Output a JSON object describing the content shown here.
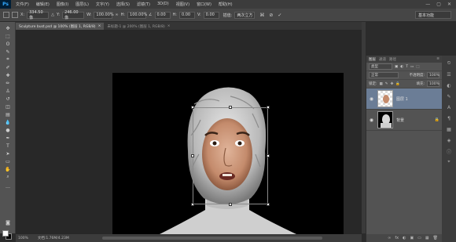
{
  "app": {
    "logo": "Ps"
  },
  "menu": [
    "文件(F)",
    "编辑(E)",
    "图像(I)",
    "图层(L)",
    "文字(Y)",
    "选择(S)",
    "滤镜(T)",
    "3D(D)",
    "视图(V)",
    "窗口(W)",
    "帮助(H)"
  ],
  "window_controls": [
    "—",
    "▢",
    "✕"
  ],
  "options": {
    "x_label": "X:",
    "x_value": "334.50 像",
    "y_label": "Y:",
    "y_value": "246.00 像",
    "w_label": "W:",
    "w_value": "100.00%",
    "h_label": "H:",
    "h_value": "100.00%",
    "angle_value": "0.00",
    "hskew_label": "H:",
    "hskew_value": "0.00",
    "vskew_label": "V:",
    "vskew_value": "0.00",
    "interp_value": "两次立方",
    "workspace": "基本功能"
  },
  "tabs": [
    {
      "label": "Sculpture bust.psd @ 100% (图层 1, RGB/8)",
      "close": "×"
    },
    {
      "label": "未标题-1 @ 200% (图层 1, RGB/8)",
      "close": "×"
    }
  ],
  "status": {
    "zoom": "100%",
    "doc": "文档:1.76M/4.23M"
  },
  "layers_panel": {
    "tabs": [
      "图层",
      "通道",
      "路径"
    ],
    "filter_kind": "类型",
    "blend_mode": "正常",
    "opacity_label": "不透明度:",
    "opacity_value": "100%",
    "lock_label": "锁定:",
    "fill_label": "填充:",
    "fill_value": "100%",
    "layers": [
      {
        "name": "图层 1",
        "visible_icon": "◉",
        "selected": true
      },
      {
        "name": "背景",
        "visible_icon": "◉",
        "selected": false,
        "lock": "🔒"
      }
    ],
    "footer_icons": [
      "fx",
      "◐",
      "▣",
      "▭",
      "▦",
      "🗑"
    ]
  },
  "colors": {
    "accent": "#31a8ff",
    "selected_layer": "#6b7d96",
    "panel": "#535353"
  }
}
